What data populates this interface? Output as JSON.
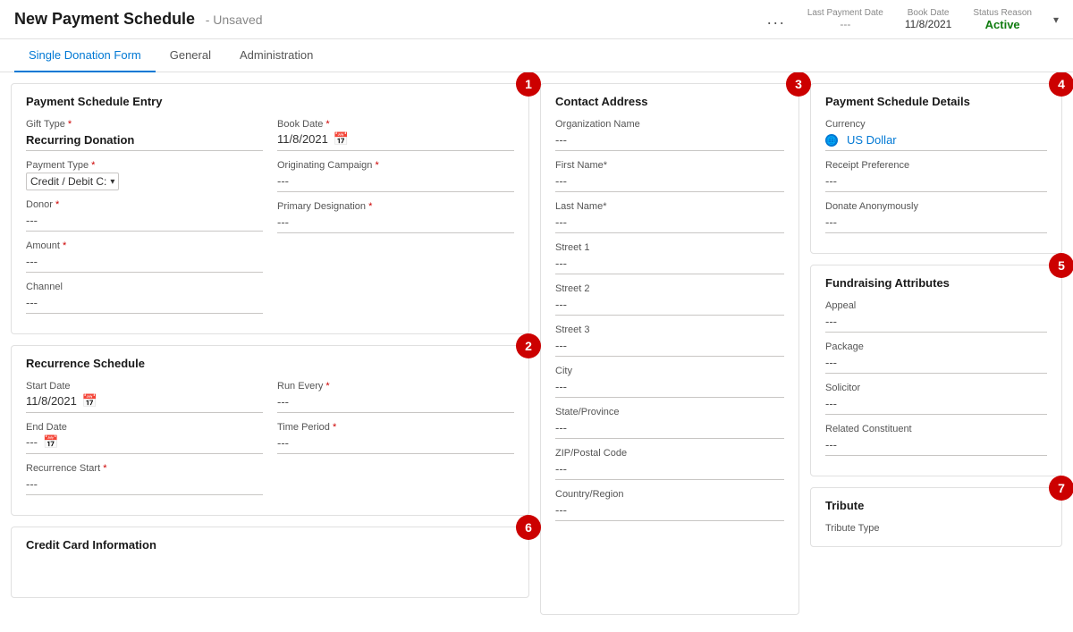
{
  "header": {
    "title": "New Payment Schedule",
    "subtitle": "- Unsaved",
    "meta_dots": "...",
    "last_payment_label": "Last Payment Date",
    "book_date_label": "Book Date",
    "book_date_value": "11/8/2021",
    "status_label": "Active",
    "status_reason_label": "Status Reason",
    "chevron": "▾"
  },
  "tabs": [
    {
      "label": "Single Donation Form",
      "active": true
    },
    {
      "label": "General",
      "active": false
    },
    {
      "label": "Administration",
      "active": false
    }
  ],
  "payment_schedule_entry": {
    "title": "Payment Schedule Entry",
    "badge": "1",
    "gift_type_label": "Gift Type",
    "gift_type_value": "Recurring Donation",
    "payment_type_label": "Payment Type",
    "payment_type_value": "Credit / Debit C:",
    "donor_label": "Donor",
    "donor_value": "---",
    "amount_label": "Amount",
    "amount_value": "---",
    "channel_label": "Channel",
    "channel_value": "---",
    "book_date_label": "Book Date",
    "book_date_value": "11/8/2021",
    "originating_campaign_label": "Originating Campaign",
    "originating_campaign_value": "---",
    "primary_designation_label": "Primary Designation",
    "primary_designation_value": "---"
  },
  "recurrence_schedule": {
    "title": "Recurrence Schedule",
    "badge": "2",
    "start_date_label": "Start Date",
    "start_date_value": "11/8/2021",
    "end_date_label": "End Date",
    "end_date_value": "---",
    "recurrence_start_label": "Recurrence Start",
    "recurrence_start_value": "---",
    "run_every_label": "Run Every",
    "run_every_value": "---",
    "time_period_label": "Time Period",
    "time_period_value": "---"
  },
  "credit_card": {
    "title": "Credit Card Information",
    "badge": "6"
  },
  "contact_address": {
    "title": "Contact Address",
    "badge": "3",
    "org_name_label": "Organization Name",
    "org_name_value": "---",
    "first_name_label": "First Name*",
    "first_name_value": "---",
    "last_name_label": "Last Name*",
    "last_name_value": "---",
    "street1_label": "Street 1",
    "street1_value": "---",
    "street2_label": "Street 2",
    "street2_value": "---",
    "street3_label": "Street 3",
    "street3_value": "---",
    "city_label": "City",
    "city_value": "---",
    "state_label": "State/Province",
    "state_value": "---",
    "zip_label": "ZIP/Postal Code",
    "zip_value": "---",
    "country_label": "Country/Region",
    "country_value": "---"
  },
  "payment_schedule_details": {
    "title": "Payment Schedule Details",
    "badge": "4",
    "currency_label": "Currency",
    "currency_value": "US Dollar",
    "receipt_pref_label": "Receipt Preference",
    "receipt_pref_value": "---",
    "donate_anon_label": "Donate Anonymously",
    "donate_anon_value": "---"
  },
  "fundraising_attributes": {
    "title": "Fundraising Attributes",
    "badge": "5",
    "appeal_label": "Appeal",
    "appeal_value": "---",
    "package_label": "Package",
    "package_value": "---",
    "solicitor_label": "Solicitor",
    "solicitor_value": "---",
    "related_constituent_label": "Related Constituent",
    "related_constituent_value": "---"
  },
  "tribute": {
    "title": "Tribute",
    "badge": "7",
    "tribute_type_label": "Tribute Type"
  }
}
